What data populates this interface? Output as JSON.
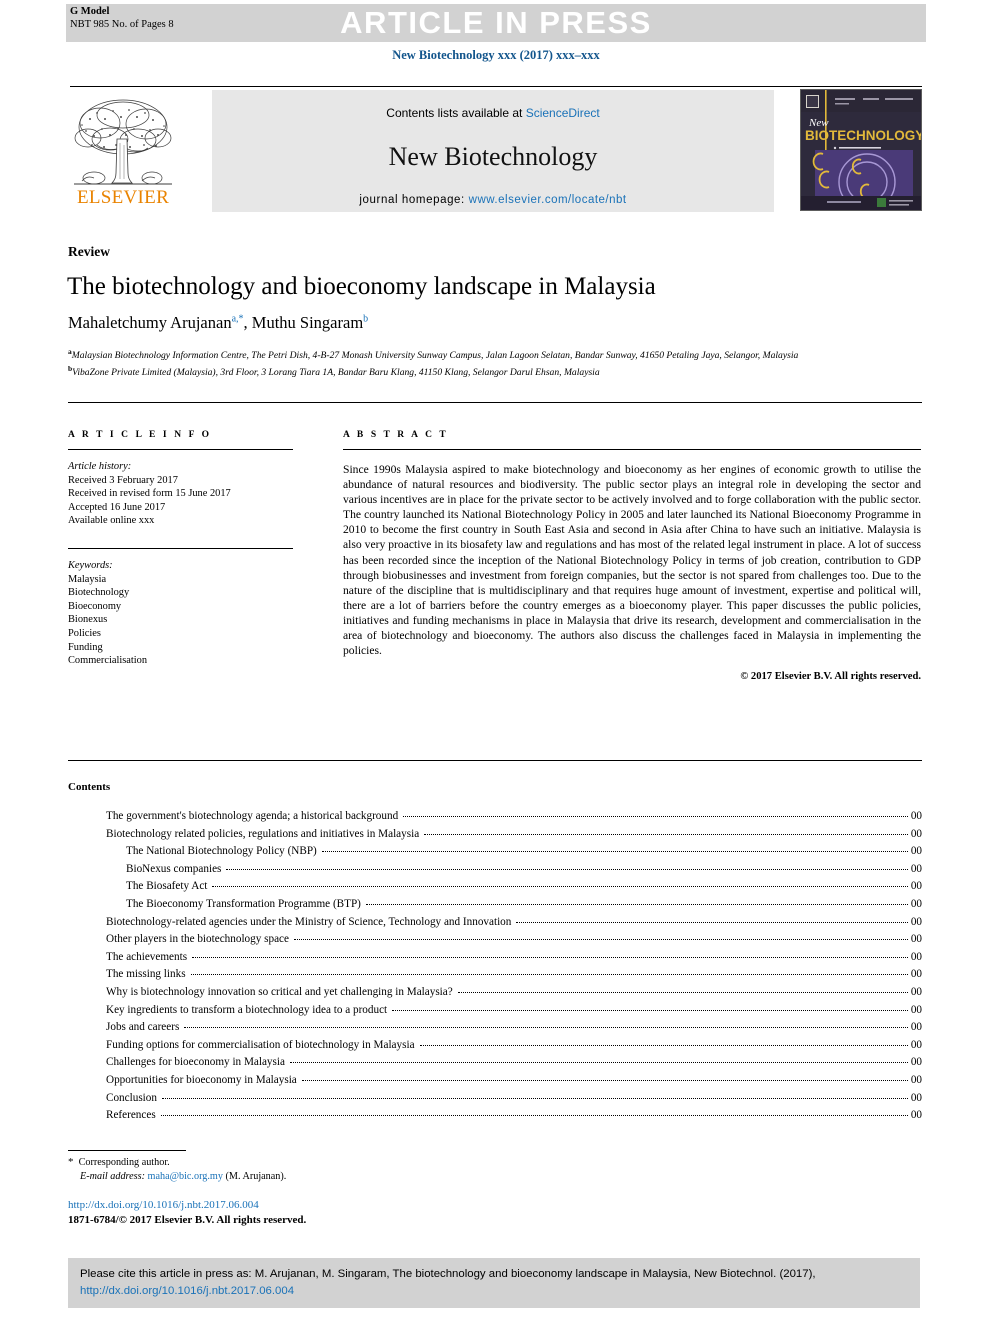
{
  "banner": {
    "article_in_press": "ARTICLE IN PRESS",
    "g_model_line1": "G Model",
    "g_model_line2": "NBT 985 No. of Pages 8"
  },
  "journal_ref": "New Biotechnology xxx (2017) xxx–xxx",
  "masthead": {
    "contents_prefix": "Contents lists available at ",
    "sciencedirect": "ScienceDirect",
    "journal_title": "New Biotechnology",
    "homepage_label": "journal homepage:",
    "homepage_url": "www.elsevier.com/locate/nbt",
    "publisher": "ELSEVIER",
    "cover_title_small": "New",
    "cover_title_main": "BIOTECHNOLOGY"
  },
  "article": {
    "section": "Review",
    "title": "The biotechnology and bioeconomy landscape in Malaysia",
    "authors": [
      {
        "name": "Mahaletchumy Arujanan",
        "marks": "a,*"
      },
      {
        "name": "Muthu Singaram",
        "marks": "b"
      }
    ],
    "authors_line_1_name": "Mahaletchumy Arujanan",
    "authors_line_1_sup": "a,",
    "authors_line_2_name": ", Muthu Singaram",
    "authors_line_2_sup": "b",
    "affiliation_a": "Malaysian Biotechnology Information Centre, The Petri Dish, 4-B-27 Monash University Sunway Campus, Jalan Lagoon Selatan, Bandar Sunway, 41650 Petaling Jaya, Selangor, Malaysia",
    "affiliation_b": "VibaZone Private Limited (Malaysia), 3rd Floor, 3 Lorang Tiara 1A, Bandar Baru Klang, 41150 Klang, Selangor Darul Ehsan, Malaysia"
  },
  "article_info": {
    "heading": "A R T I C L E   I N F O",
    "history_label": "Article history:",
    "history": [
      "Received 3 February 2017",
      "Received in revised form 15 June 2017",
      "Accepted 16 June 2017",
      "Available online xxx"
    ],
    "keywords_label": "Keywords:",
    "keywords": [
      "Malaysia",
      "Biotechnology",
      "Bioeconomy",
      "Bionexus",
      "Policies",
      "Funding",
      "Commercialisation"
    ]
  },
  "abstract": {
    "heading": "A B S T R A C T",
    "text": "Since 1990s Malaysia aspired to make biotechnology and bioeconomy as her engines of economic growth to utilise the abundance of natural resources and biodiversity. The public sector plays an integral role in developing the sector and various incentives are in place for the private sector to be actively involved and to forge collaboration with the public sector. The country launched its National Biotechnology Policy in 2005 and later launched its National Bioeconomy Programme in 2010 to become the first country in South East Asia and second in Asia after China to have such an initiative. Malaysia is also very proactive in its biosafety law and regulations and has most of the related legal instrument in place. A lot of success has been recorded since the inception of the National Biotechnology Policy in terms of job creation, contribution to GDP through biobusinesses and investment from foreign companies, but the sector is not spared from challenges too. Due to the nature of the discipline that is multidisciplinary and that requires huge amount of investment, expertise and political will, there are a lot of barriers before the country emerges as a bioeconomy player. This paper discusses the public policies, initiatives and funding mechanisms in place in Malaysia that drive its research, development and commercialisation in the area of biotechnology and bioeconomy. The authors also discuss the challenges faced in Malaysia in implementing the policies.",
    "copyright": "© 2017 Elsevier B.V. All rights reserved."
  },
  "contents": {
    "heading": "Contents",
    "items": [
      {
        "label": "The government's biotechnology agenda; a historical background",
        "page": "00",
        "level": 1
      },
      {
        "label": "Biotechnology related policies, regulations and initiatives in Malaysia",
        "page": "00",
        "level": 1
      },
      {
        "label": "The National Biotechnology Policy (NBP)",
        "page": "00",
        "level": 2
      },
      {
        "label": "BioNexus companies",
        "page": "00",
        "level": 2
      },
      {
        "label": "The Biosafety Act",
        "page": "00",
        "level": 2
      },
      {
        "label": "The Bioeconomy Transformation Programme (BTP)",
        "page": "00",
        "level": 2
      },
      {
        "label": "Biotechnology-related agencies under the Ministry of Science, Technology and Innovation",
        "page": "00",
        "level": 1
      },
      {
        "label": "Other players in the biotechnology space",
        "page": "00",
        "level": 1
      },
      {
        "label": "The achievements",
        "page": "00",
        "level": 1
      },
      {
        "label": "The missing links",
        "page": "00",
        "level": 1
      },
      {
        "label": "Why is biotechnology innovation so critical and yet challenging in Malaysia?",
        "page": "00",
        "level": 1
      },
      {
        "label": "Key ingredients to transform a biotechnology idea to a product",
        "page": "00",
        "level": 1
      },
      {
        "label": "Jobs and careers",
        "page": "00",
        "level": 1
      },
      {
        "label": "Funding options for commercialisation of biotechnology in Malaysia",
        "page": "00",
        "level": 1
      },
      {
        "label": "Challenges for bioeconomy in Malaysia",
        "page": "00",
        "level": 1
      },
      {
        "label": "Opportunities for bioeconomy in Malaysia",
        "page": "00",
        "level": 1
      },
      {
        "label": "Conclusion",
        "page": "00",
        "level": 1
      },
      {
        "label": "References",
        "page": "00",
        "level": 1
      }
    ]
  },
  "footnotes": {
    "corresponding_author": "Corresponding author.",
    "email_label": "E-mail address:",
    "email": "maha@bic.org.my",
    "email_attrib": "(M. Arujanan).",
    "doi": "http://dx.doi.org/10.1016/j.nbt.2017.06.004",
    "issn_line": "1871-6784/© 2017 Elsevier B.V. All rights reserved."
  },
  "cite_box": {
    "text_part1": "Please cite this article in press as: M. Arujanan, M. Singaram, The biotechnology and bioeconomy landscape in Malaysia, New Biotechnol.",
    "text_part2": "(2017),",
    "doi": "http://dx.doi.org/10.1016/j.nbt.2017.06.004"
  },
  "colors": {
    "link_blue": "#1a72b8",
    "header_blue": "#12558c",
    "banner_gray": "#d2d2d2",
    "masthead_gray": "#e7e7e7",
    "elsevier_orange": "#e98300"
  }
}
